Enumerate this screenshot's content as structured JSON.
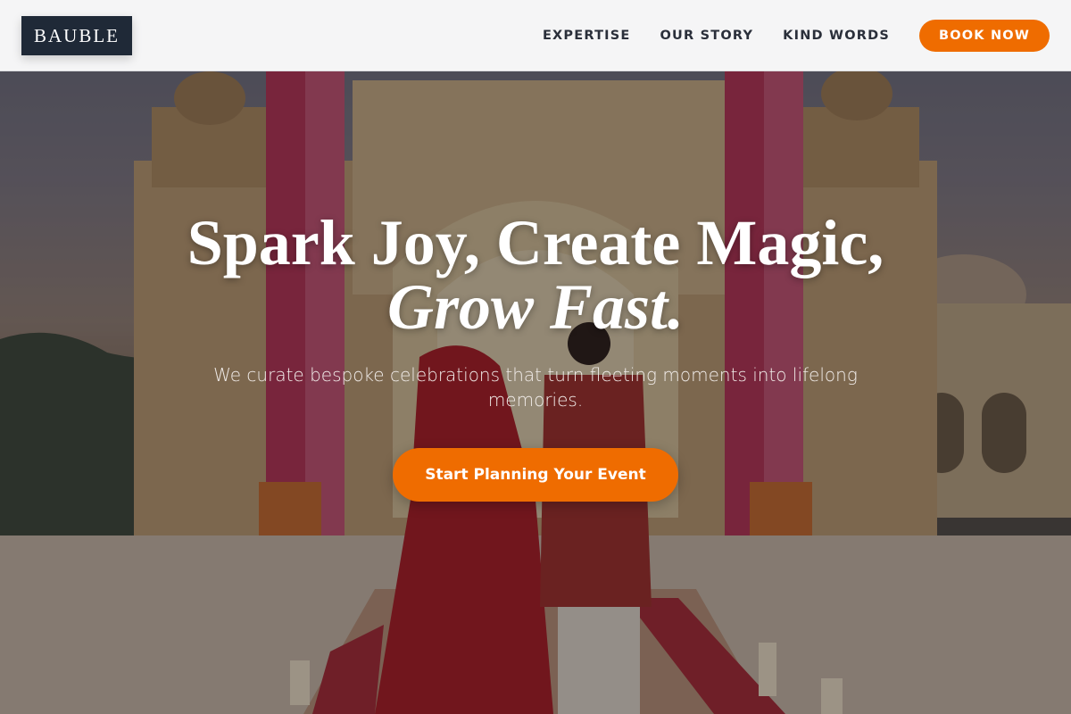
{
  "brand": {
    "name": "BAUBLE"
  },
  "nav": {
    "items": [
      {
        "label": "EXPERTISE"
      },
      {
        "label": "OUR STORY"
      },
      {
        "label": "KIND WORDS"
      }
    ],
    "cta_label": "BOOK NOW"
  },
  "hero": {
    "headline_line1": "Spark Joy, Create Magic,",
    "headline_line2": "Grow Fast.",
    "subheadline": "We curate bespoke celebrations that turn fleeting moments into lifelong memories.",
    "cta_label": "Start Planning Your Event"
  },
  "colors": {
    "accent": "#ef6c00",
    "logo_bg": "#1f2937",
    "header_bg": "#f5f5f6"
  }
}
